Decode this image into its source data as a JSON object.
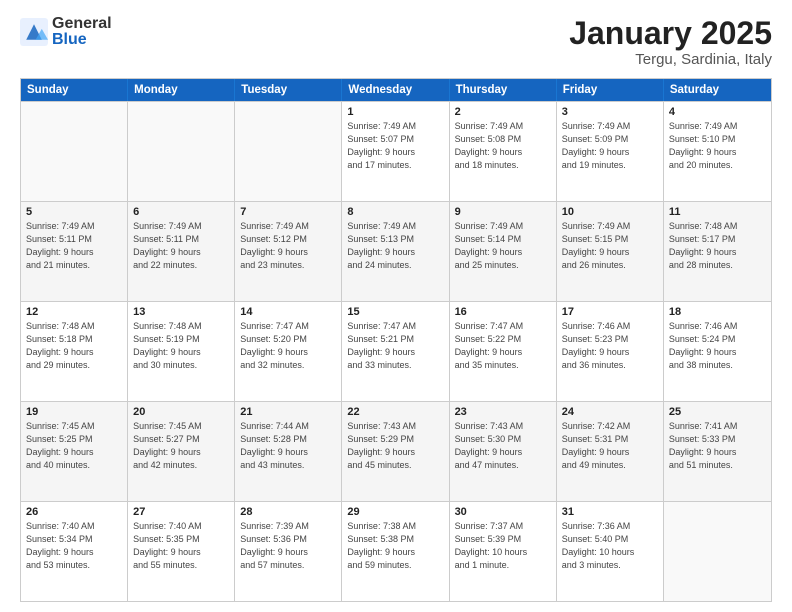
{
  "logo": {
    "general": "General",
    "blue": "Blue"
  },
  "title": "January 2025",
  "subtitle": "Tergu, Sardinia, Italy",
  "header_days": [
    "Sunday",
    "Monday",
    "Tuesday",
    "Wednesday",
    "Thursday",
    "Friday",
    "Saturday"
  ],
  "weeks": [
    [
      {
        "day": "",
        "info": ""
      },
      {
        "day": "",
        "info": ""
      },
      {
        "day": "",
        "info": ""
      },
      {
        "day": "1",
        "info": "Sunrise: 7:49 AM\nSunset: 5:07 PM\nDaylight: 9 hours\nand 17 minutes."
      },
      {
        "day": "2",
        "info": "Sunrise: 7:49 AM\nSunset: 5:08 PM\nDaylight: 9 hours\nand 18 minutes."
      },
      {
        "day": "3",
        "info": "Sunrise: 7:49 AM\nSunset: 5:09 PM\nDaylight: 9 hours\nand 19 minutes."
      },
      {
        "day": "4",
        "info": "Sunrise: 7:49 AM\nSunset: 5:10 PM\nDaylight: 9 hours\nand 20 minutes."
      }
    ],
    [
      {
        "day": "5",
        "info": "Sunrise: 7:49 AM\nSunset: 5:11 PM\nDaylight: 9 hours\nand 21 minutes."
      },
      {
        "day": "6",
        "info": "Sunrise: 7:49 AM\nSunset: 5:11 PM\nDaylight: 9 hours\nand 22 minutes."
      },
      {
        "day": "7",
        "info": "Sunrise: 7:49 AM\nSunset: 5:12 PM\nDaylight: 9 hours\nand 23 minutes."
      },
      {
        "day": "8",
        "info": "Sunrise: 7:49 AM\nSunset: 5:13 PM\nDaylight: 9 hours\nand 24 minutes."
      },
      {
        "day": "9",
        "info": "Sunrise: 7:49 AM\nSunset: 5:14 PM\nDaylight: 9 hours\nand 25 minutes."
      },
      {
        "day": "10",
        "info": "Sunrise: 7:49 AM\nSunset: 5:15 PM\nDaylight: 9 hours\nand 26 minutes."
      },
      {
        "day": "11",
        "info": "Sunrise: 7:48 AM\nSunset: 5:17 PM\nDaylight: 9 hours\nand 28 minutes."
      }
    ],
    [
      {
        "day": "12",
        "info": "Sunrise: 7:48 AM\nSunset: 5:18 PM\nDaylight: 9 hours\nand 29 minutes."
      },
      {
        "day": "13",
        "info": "Sunrise: 7:48 AM\nSunset: 5:19 PM\nDaylight: 9 hours\nand 30 minutes."
      },
      {
        "day": "14",
        "info": "Sunrise: 7:47 AM\nSunset: 5:20 PM\nDaylight: 9 hours\nand 32 minutes."
      },
      {
        "day": "15",
        "info": "Sunrise: 7:47 AM\nSunset: 5:21 PM\nDaylight: 9 hours\nand 33 minutes."
      },
      {
        "day": "16",
        "info": "Sunrise: 7:47 AM\nSunset: 5:22 PM\nDaylight: 9 hours\nand 35 minutes."
      },
      {
        "day": "17",
        "info": "Sunrise: 7:46 AM\nSunset: 5:23 PM\nDaylight: 9 hours\nand 36 minutes."
      },
      {
        "day": "18",
        "info": "Sunrise: 7:46 AM\nSunset: 5:24 PM\nDaylight: 9 hours\nand 38 minutes."
      }
    ],
    [
      {
        "day": "19",
        "info": "Sunrise: 7:45 AM\nSunset: 5:25 PM\nDaylight: 9 hours\nand 40 minutes."
      },
      {
        "day": "20",
        "info": "Sunrise: 7:45 AM\nSunset: 5:27 PM\nDaylight: 9 hours\nand 42 minutes."
      },
      {
        "day": "21",
        "info": "Sunrise: 7:44 AM\nSunset: 5:28 PM\nDaylight: 9 hours\nand 43 minutes."
      },
      {
        "day": "22",
        "info": "Sunrise: 7:43 AM\nSunset: 5:29 PM\nDaylight: 9 hours\nand 45 minutes."
      },
      {
        "day": "23",
        "info": "Sunrise: 7:43 AM\nSunset: 5:30 PM\nDaylight: 9 hours\nand 47 minutes."
      },
      {
        "day": "24",
        "info": "Sunrise: 7:42 AM\nSunset: 5:31 PM\nDaylight: 9 hours\nand 49 minutes."
      },
      {
        "day": "25",
        "info": "Sunrise: 7:41 AM\nSunset: 5:33 PM\nDaylight: 9 hours\nand 51 minutes."
      }
    ],
    [
      {
        "day": "26",
        "info": "Sunrise: 7:40 AM\nSunset: 5:34 PM\nDaylight: 9 hours\nand 53 minutes."
      },
      {
        "day": "27",
        "info": "Sunrise: 7:40 AM\nSunset: 5:35 PM\nDaylight: 9 hours\nand 55 minutes."
      },
      {
        "day": "28",
        "info": "Sunrise: 7:39 AM\nSunset: 5:36 PM\nDaylight: 9 hours\nand 57 minutes."
      },
      {
        "day": "29",
        "info": "Sunrise: 7:38 AM\nSunset: 5:38 PM\nDaylight: 9 hours\nand 59 minutes."
      },
      {
        "day": "30",
        "info": "Sunrise: 7:37 AM\nSunset: 5:39 PM\nDaylight: 10 hours\nand 1 minute."
      },
      {
        "day": "31",
        "info": "Sunrise: 7:36 AM\nSunset: 5:40 PM\nDaylight: 10 hours\nand 3 minutes."
      },
      {
        "day": "",
        "info": ""
      }
    ]
  ]
}
